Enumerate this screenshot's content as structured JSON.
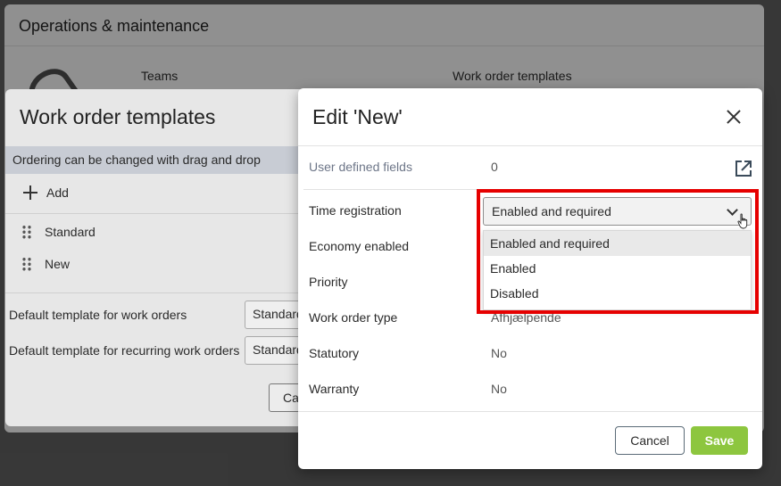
{
  "background": {
    "title": "Operations & maintenance",
    "teams_label": "Teams",
    "templates_label": "Work order templates"
  },
  "left_modal": {
    "title": "Work order templates",
    "info": "Ordering can be changed with drag and drop",
    "add_label": "Add",
    "items": [
      "Standard",
      "New"
    ],
    "default_work_orders_label": "Default template for work orders",
    "default_work_orders_value": "Standard",
    "default_recurring_label": "Default template for recurring work orders",
    "default_recurring_value": "Standard",
    "cancel_partial": "Ca"
  },
  "edit_modal": {
    "title": "Edit 'New'",
    "fields": {
      "user_defined_label": "User defined fields",
      "user_defined_value": "0",
      "time_registration_label": "Time registration",
      "time_registration_value": "Enabled and required",
      "economy_label": "Economy enabled",
      "priority_label": "Priority",
      "work_order_type_label": "Work order type",
      "work_order_type_value": "Afhjælpende",
      "statutory_label": "Statutory",
      "statutory_value": "No",
      "warranty_label": "Warranty",
      "warranty_value": "No"
    },
    "dropdown_options": [
      "Enabled and required",
      "Enabled",
      "Disabled"
    ],
    "cancel_label": "Cancel",
    "save_label": "Save"
  },
  "colors": {
    "save_green": "#8dc63f",
    "highlight_red": "#e60000",
    "info_bar": "#c8ccd4"
  },
  "icons": [
    "close-icon",
    "external-link-icon",
    "chevron-down-icon",
    "plus-icon",
    "drag-handle-icon",
    "hand-cursor-icon",
    "wrench-icon"
  ]
}
